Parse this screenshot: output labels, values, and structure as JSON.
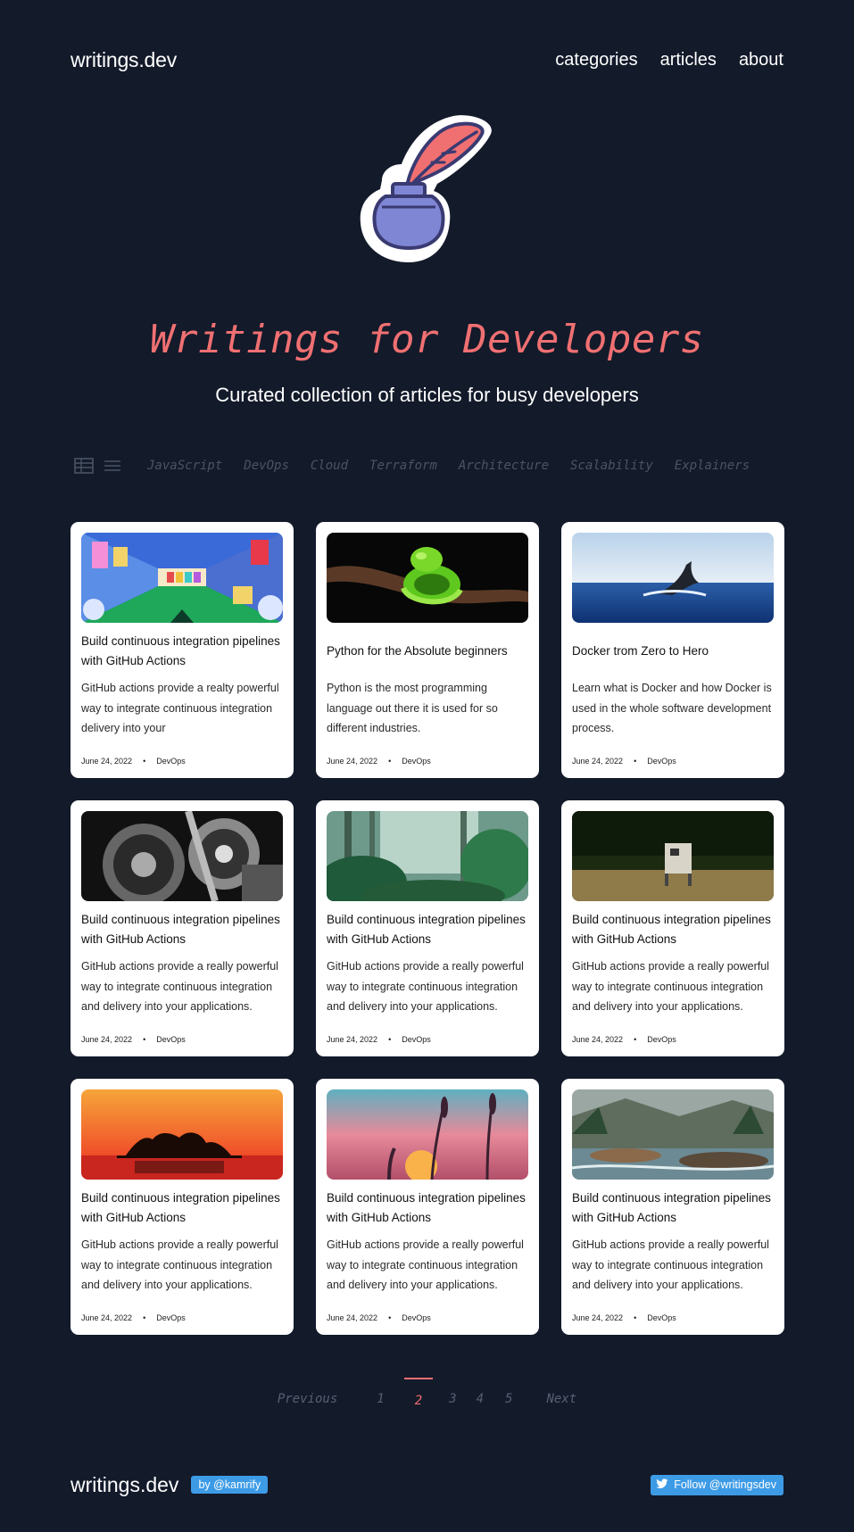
{
  "header": {
    "brand": "writings.dev",
    "nav": [
      "categories",
      "articles",
      "about"
    ]
  },
  "hero": {
    "logo_icon": "quill-inkpot-icon",
    "title": "Writings for Developers",
    "subtitle": "Curated collection of articles for busy developers"
  },
  "filter": {
    "view_icons": [
      "grid-view-icon",
      "list-view-icon"
    ],
    "categories": [
      "JavaScript",
      "DevOps",
      "Cloud",
      "Terraform",
      "Architecture",
      "Scalability",
      "Explainers"
    ]
  },
  "articles": [
    {
      "title": "Build continuous integration pipelines with GitHub Actions",
      "desc": "GitHub actions provide a realty powerful way to integrate continuous integration delivery into your",
      "date": "June 24, 2022",
      "category": "DevOps",
      "image": "colorful-corridor-illustration"
    },
    {
      "title": "Python for the Absolute beginners",
      "desc": "Python is the most programming language out there it is used for so different industries.",
      "date": "June 24, 2022",
      "category": "DevOps",
      "image": "green-snake-on-branch"
    },
    {
      "title": "Docker trom Zero to Hero",
      "desc": "Learn what is Docker and how Docker is used in the whole software development process.",
      "date": "June 24, 2022",
      "category": "DevOps",
      "image": "whale-tail-in-ocean"
    },
    {
      "title": "Build continuous integration pipelines with GitHub Actions",
      "desc": "GitHub actions provide a really powerful way to integrate continuous integration and delivery into your applications.",
      "date": "June 24, 2022",
      "category": "DevOps",
      "image": "black-white-gears"
    },
    {
      "title": "Build continuous integration pipelines with GitHub Actions",
      "desc": "GitHub actions provide a really powerful way to integrate continuous integration and delivery into your applications.",
      "date": "June 24, 2022",
      "category": "DevOps",
      "image": "misty-jungle"
    },
    {
      "title": "Build continuous integration pipelines with GitHub Actions",
      "desc": "GitHub actions provide a really powerful way to integrate continuous integration and delivery into your applications.",
      "date": "June 24, 2022",
      "category": "DevOps",
      "image": "small-robot-in-field"
    },
    {
      "title": "Build continuous integration pipelines with GitHub Actions",
      "desc": "GitHub actions provide a really powerful way to integrate continuous integration and delivery into your applications.",
      "date": "June 24, 2022",
      "category": "DevOps",
      "image": "island-sunset"
    },
    {
      "title": "Build continuous integration pipelines with GitHub Actions",
      "desc": "GitHub actions provide a really powerful way to integrate continuous integration and delivery into your applications.",
      "date": "June 24, 2022",
      "category": "DevOps",
      "image": "sunset-grass-silhouette"
    },
    {
      "title": "Build continuous integration pipelines with GitHub Actions",
      "desc": "GitHub actions provide a really powerful way to integrate continuous integration and delivery into your applications.",
      "date": "June 24, 2022",
      "category": "DevOps",
      "image": "misty-river-forest"
    }
  ],
  "pagination": {
    "prev": "Previous",
    "pages": [
      "1",
      "2",
      "3",
      "4",
      "5"
    ],
    "current": "2",
    "next": "Next"
  },
  "footer": {
    "brand": "writings.dev",
    "author_badge": "by @kamrify",
    "follow_label": "Follow @writingsdev",
    "follow_icon": "twitter-bird-icon"
  },
  "colors": {
    "background": "#131a2a",
    "accent": "#f07072",
    "muted": "#4a5465",
    "badge": "#3d9be6"
  }
}
